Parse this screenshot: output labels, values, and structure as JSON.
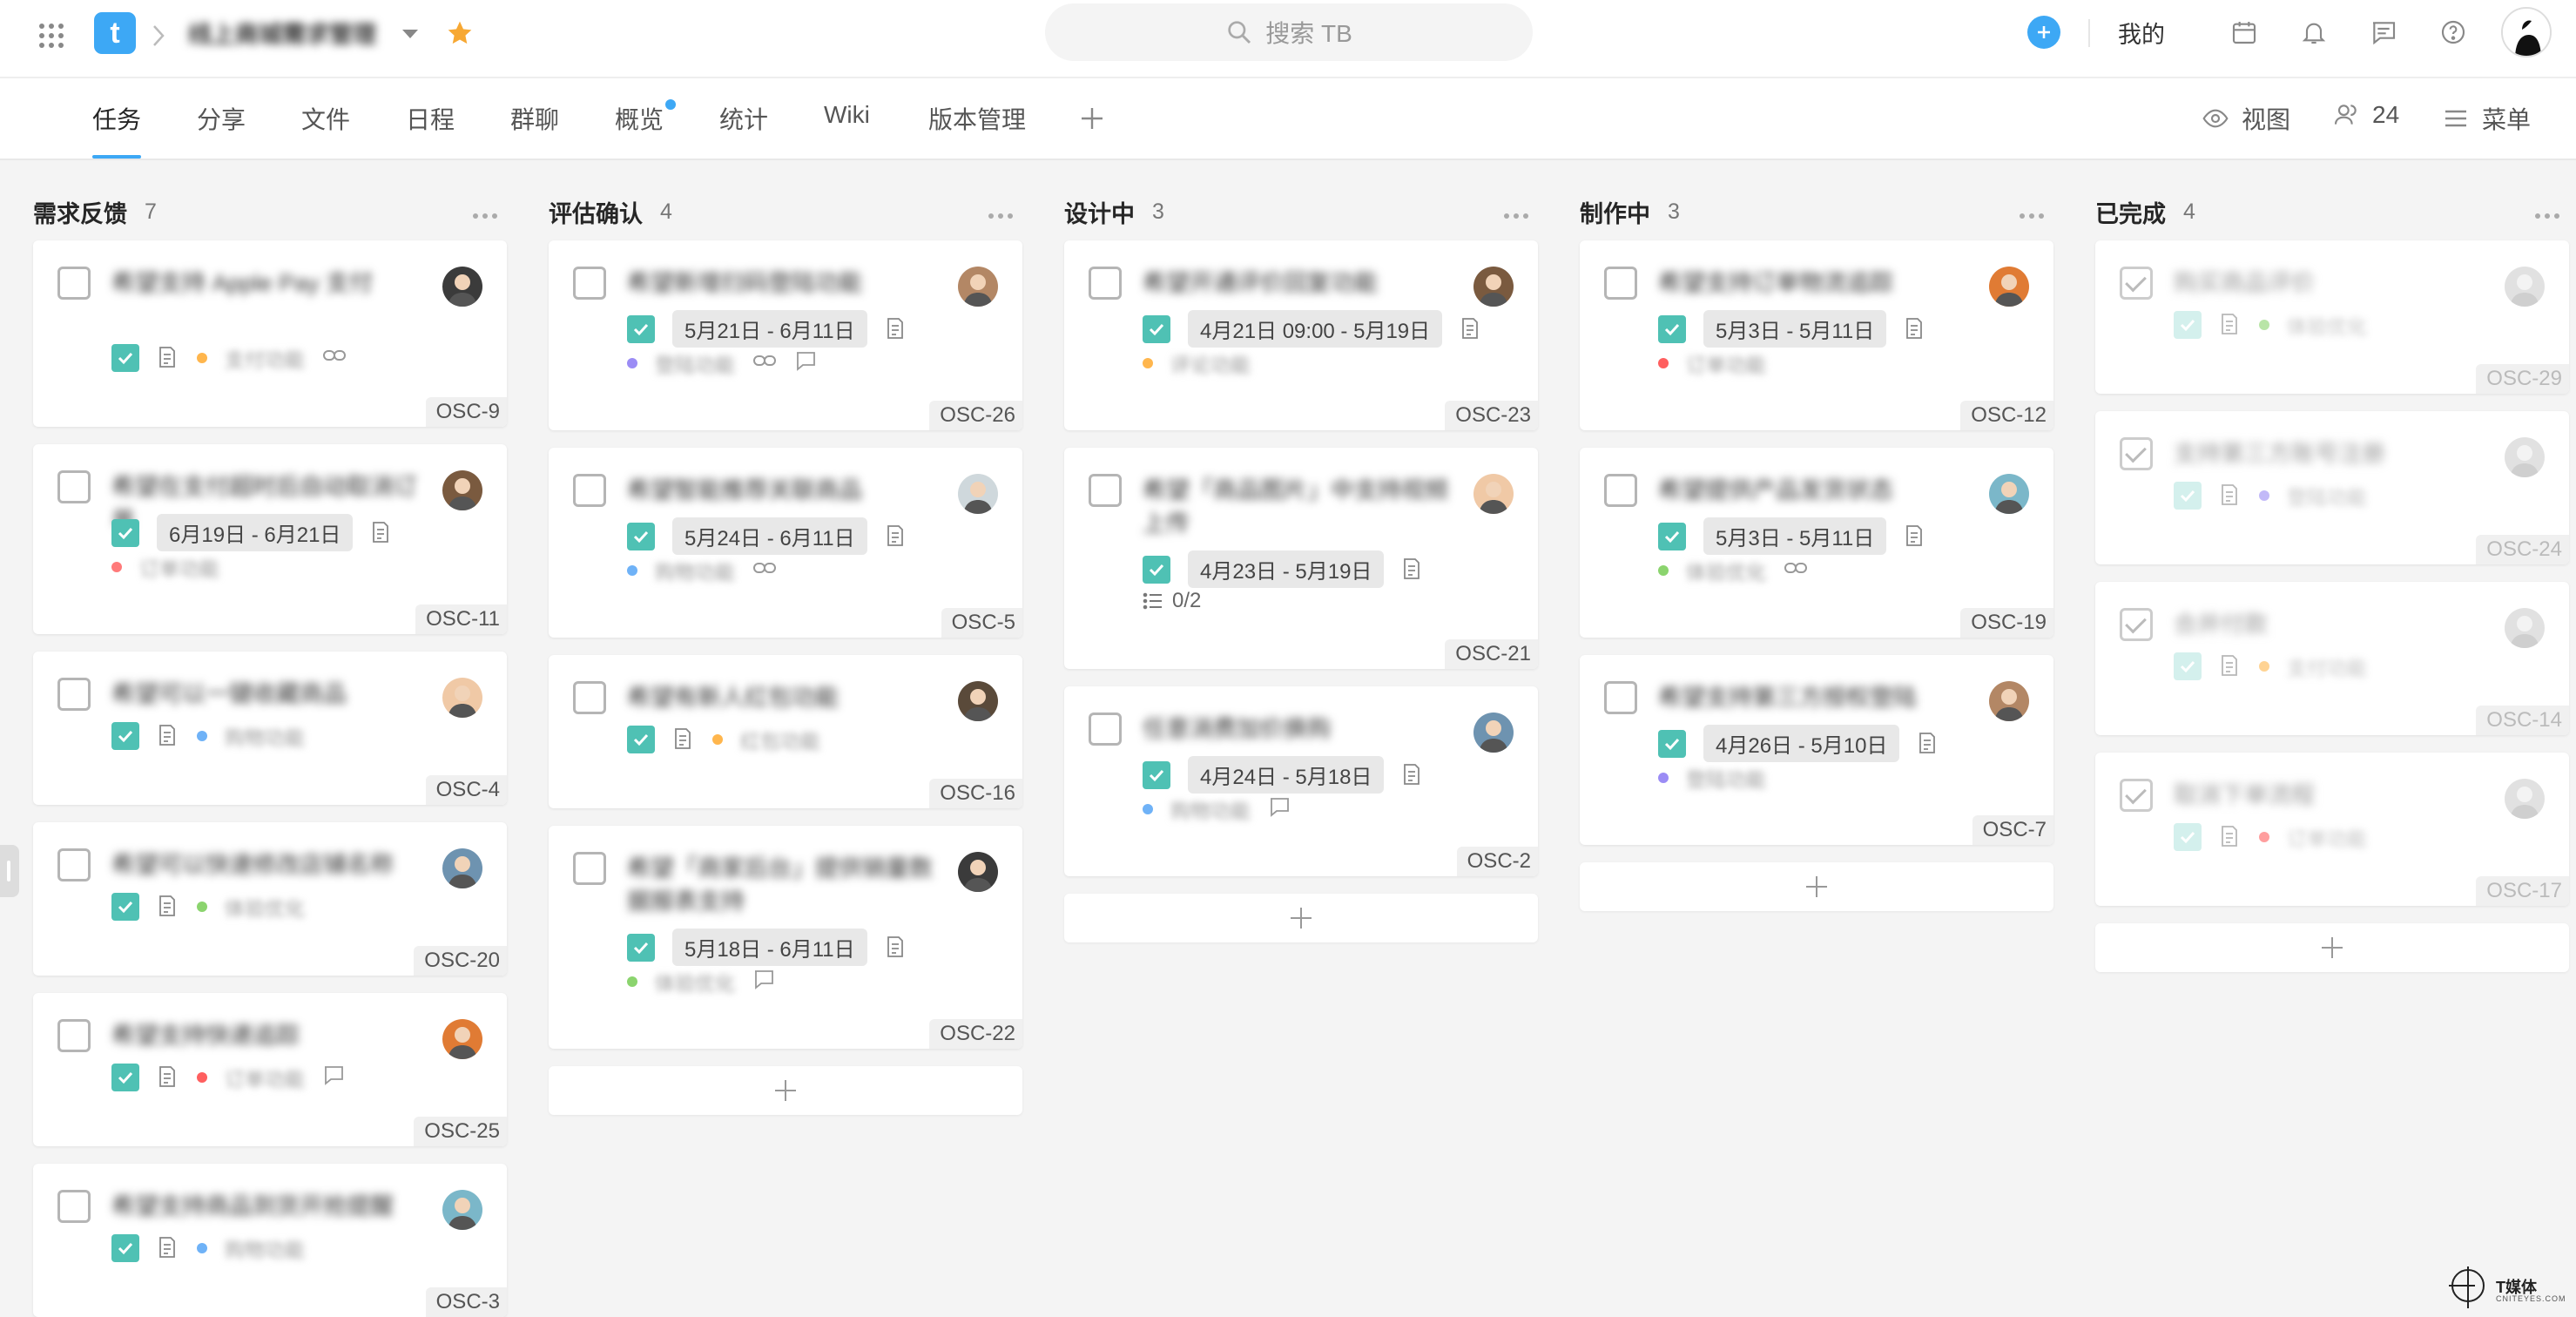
{
  "header": {
    "project_title": "线上商城需求管理",
    "search_placeholder": "搜索 TB",
    "mine_label": "我的",
    "logo_letter": "t"
  },
  "tabs": [
    {
      "label": "任务",
      "active": true
    },
    {
      "label": "分享"
    },
    {
      "label": "文件"
    },
    {
      "label": "日程"
    },
    {
      "label": "群聊"
    },
    {
      "label": "概览",
      "badge": true
    },
    {
      "label": "统计"
    },
    {
      "label": "Wiki"
    },
    {
      "label": "版本管理"
    }
  ],
  "toolbar": {
    "view_label": "视图",
    "members_count": "24",
    "menu_label": "菜单"
  },
  "colors": {
    "accent": "#3da8f5",
    "check": "#4fc1b4"
  },
  "columns": [
    {
      "name": "需求反馈",
      "count": "7",
      "cards": [
        {
          "title": "希望支持 Apple Pay 支付",
          "tag": "支付功能",
          "tag_color": "#ffb64d",
          "code": "OSC-9",
          "link": true
        },
        {
          "title": "希望在支付超时后自动取消订单",
          "date": "6月19日 - 6月21日",
          "tag": "订单功能",
          "tag_color": "#ff7a7a",
          "code": "OSC-11"
        },
        {
          "title": "希望可以一键收藏商品",
          "tag": "购物功能",
          "tag_color": "#6fb2f7",
          "code": "OSC-4"
        },
        {
          "title": "希望可以快速修改店铺名称",
          "tag": "体验优化",
          "tag_color": "#8bd46e",
          "code": "OSC-20"
        },
        {
          "title": "希望支持快递追踪",
          "tag": "订单功能",
          "tag_color": "#ff5f5f",
          "code": "OSC-25",
          "comment": true
        },
        {
          "title": "希望支持商品到货开抢提醒",
          "tag": "购物功能",
          "tag_color": "#6fb2f7",
          "code": "OSC-3"
        }
      ]
    },
    {
      "name": "评估确认",
      "count": "4",
      "cards": [
        {
          "title": "希望新增扫码登陆功能",
          "date": "5月21日 - 6月11日",
          "tag": "登陆功能",
          "tag_color": "#9b8cf5",
          "code": "OSC-26",
          "link": true,
          "comment": true
        },
        {
          "title": "希望智能推荐关联商品",
          "date": "5月24日 - 6月11日",
          "tag": "购物功能",
          "tag_color": "#6fb2f7",
          "code": "OSC-5",
          "link": true
        },
        {
          "title": "希望有新人红包功能",
          "tag": "红包功能",
          "tag_color": "#ffb64d",
          "code": "OSC-16"
        },
        {
          "title": "希望「商家后台」提供销量数据报表支持",
          "date": "5月18日 - 6月11日",
          "tag": "体验优化",
          "tag_color": "#8bd46e",
          "code": "OSC-22",
          "comment": true
        }
      ]
    },
    {
      "name": "设计中",
      "count": "3",
      "cards": [
        {
          "title": "希望开通评价回复功能",
          "date": "4月21日 09:00 - 5月19日",
          "tag": "评论功能",
          "tag_color": "#ffb64d",
          "code": "OSC-23"
        },
        {
          "title": "希望「商品图片」中支持视频上传",
          "date": "4月23日 - 5月19日",
          "subtasks": "0/2",
          "code": "OSC-21"
        },
        {
          "title": "任意消费加价换购",
          "date": "4月24日 - 5月18日",
          "tag": "购物功能",
          "tag_color": "#6fb2f7",
          "code": "OSC-2",
          "comment": true
        }
      ]
    },
    {
      "name": "制作中",
      "count": "3",
      "cards": [
        {
          "title": "希望支持订单物流追踪",
          "date": "5月3日 - 5月11日",
          "tag": "订单功能",
          "tag_color": "#ff5f5f",
          "code": "OSC-12"
        },
        {
          "title": "希望提供产品发货状态",
          "date": "5月3日 - 5月11日",
          "tag": "体验优化",
          "tag_color": "#8bd46e",
          "code": "OSC-19",
          "link": true
        },
        {
          "title": "希望支持第三方授权登陆",
          "date": "4月26日 - 5月10日",
          "tag": "登陆功能",
          "tag_color": "#9b8cf5",
          "code": "OSC-7"
        }
      ]
    },
    {
      "name": "已完成",
      "count": "4",
      "cards": [
        {
          "title": "购买商品评价",
          "tag": "体验优化",
          "tag_color": "#8bd46e",
          "code": "OSC-29"
        },
        {
          "title": "支持第三方账号注册",
          "tag": "登陆功能",
          "tag_color": "#9b8cf5",
          "code": "OSC-24"
        },
        {
          "title": "合并付款",
          "tag": "支付功能",
          "tag_color": "#ffb64d",
          "code": "OSC-14"
        },
        {
          "title": "取消下单流程",
          "tag": "订单功能",
          "tag_color": "#ff5f5f",
          "code": "OSC-17"
        }
      ]
    }
  ],
  "watermark": {
    "name": "T媒体",
    "sub": "CNITEYES.COM"
  }
}
